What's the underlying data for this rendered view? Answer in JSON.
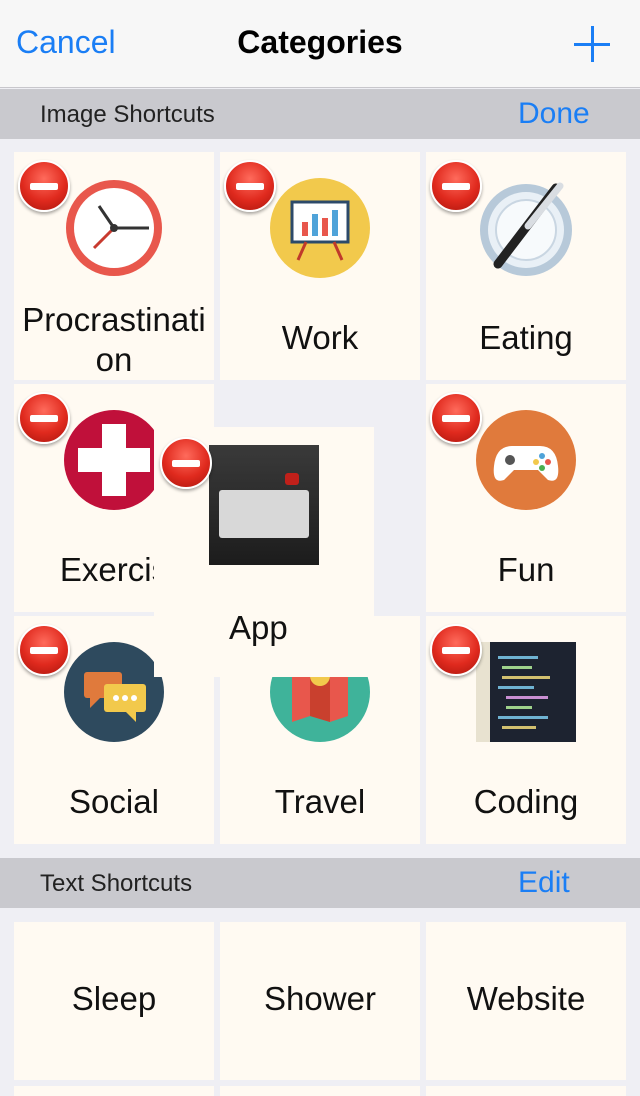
{
  "navbar": {
    "cancel_label": "Cancel",
    "title": "Categories",
    "add_icon": "plus-icon"
  },
  "image_section": {
    "title": "Image Shortcuts",
    "action_label": "Done"
  },
  "image_tiles": [
    {
      "label_line1": "Procrastinati",
      "label_line2": "on",
      "icon": "clock-icon"
    },
    {
      "label": "Work",
      "icon": "presentation-easel-icon"
    },
    {
      "label": "Eating",
      "icon": "plate-knife-icon"
    },
    {
      "label": "Exercis",
      "icon": "medical-cross-icon"
    },
    {
      "label": "Fun",
      "icon": "gamepad-icon"
    },
    {
      "label": "Social",
      "icon": "chat-bubbles-icon"
    },
    {
      "label": "Travel",
      "icon": "map-icon"
    },
    {
      "label": "Coding",
      "icon": "code-screen-icon"
    }
  ],
  "dragging_tile": {
    "label": "App",
    "icon": "app-screenshot-icon"
  },
  "text_section": {
    "title": "Text Shortcuts",
    "action_label": "Edit"
  },
  "text_tiles": [
    {
      "label": "Sleep"
    },
    {
      "label": "Shower"
    },
    {
      "label": "Website"
    }
  ],
  "colors": {
    "accent": "#1a7ef5",
    "delete_red": "#e02a1e",
    "tile_bg": "#fffaf2",
    "section_bg": "#c9c9ce"
  }
}
